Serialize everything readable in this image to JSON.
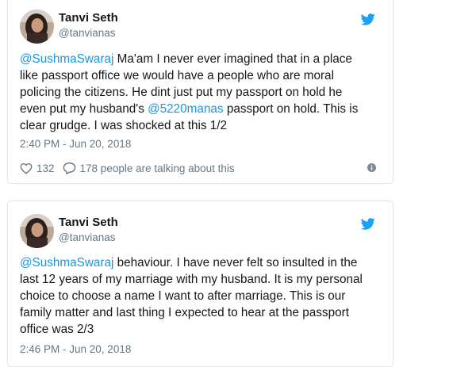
{
  "tweets": [
    {
      "author_name": "Tanvi Seth",
      "author_handle": "@tanvianas",
      "text_lines": [
        [
          {
            "t": "@SushmaSwaraj",
            "m": true
          },
          {
            "t": " Ma'am I never ever imagined that in a place"
          }
        ],
        [
          {
            "t": "like passport office we would have a people who are moral"
          }
        ],
        [
          {
            "t": "policing the citizens. He dint just put my passport on hold he"
          }
        ],
        [
          {
            "t": "even put my husband's "
          },
          {
            "t": "@5220manas",
            "m": true
          },
          {
            "t": " passport on hold. This is"
          }
        ],
        [
          {
            "t": "clear grudge. I was shocked at this 1/2"
          }
        ]
      ],
      "timestamp": "2:40 PM - Jun 20, 2018",
      "like_count": "132",
      "talking_text": "178 people are talking about this"
    },
    {
      "author_name": "Tanvi Seth",
      "author_handle": "@tanvianas",
      "text_lines": [
        [
          {
            "t": "@SushmaSwaraj",
            "m": true
          },
          {
            "t": " behaviour. I have never felt so insulted in the"
          }
        ],
        [
          {
            "t": "last 12 years of my marriage with my husband. It is my personal"
          }
        ],
        [
          {
            "t": "choice to choose a name I want to after marriage. This is our"
          }
        ],
        [
          {
            "t": "family matter and last thing I expected to hear at the passport"
          }
        ],
        [
          {
            "t": "office was 2/3"
          }
        ]
      ],
      "timestamp": "2:46 PM - Jun 20, 2018"
    }
  ],
  "icons": {
    "bird": "twitter-bird-icon",
    "like": "heart-icon",
    "reply": "speech-bubble-icon",
    "info": "info-icon"
  },
  "colors": {
    "link": "#1b95e0",
    "muted": "#657786",
    "text": "#14171a",
    "border": "#e1e8ed"
  }
}
